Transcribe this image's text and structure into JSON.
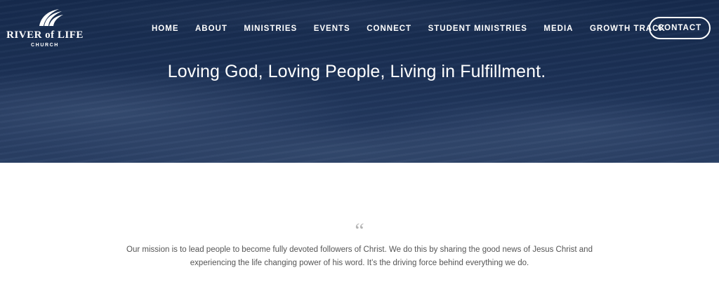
{
  "brand": {
    "name": "RIVER of LIFE",
    "subtitle": "CHURCH",
    "logo_icon": "river-wave-icon"
  },
  "nav": {
    "items": [
      {
        "label": "HOME"
      },
      {
        "label": "ABOUT"
      },
      {
        "label": "MINISTRIES"
      },
      {
        "label": "EVENTS"
      },
      {
        "label": "CONNECT"
      },
      {
        "label": "STUDENT MINISTRIES"
      },
      {
        "label": "MEDIA"
      },
      {
        "label": "GROWTH TRACK"
      }
    ],
    "contact_label": "CONTACT"
  },
  "hero": {
    "tagline": "Loving God, Loving People, Living in Fulfillment."
  },
  "mission": {
    "quote_mark": "“",
    "text": "Our mission is to lead people to become fully devoted followers of Christ. We do this by sharing the good news of Jesus Christ and experiencing the life changing power of his word. It’s the driving force behind everything we do."
  },
  "colors": {
    "hero_bg": "#1c3156",
    "text_light": "#ffffff",
    "body_text": "#555555",
    "quote_mark": "#b3b3b3"
  }
}
